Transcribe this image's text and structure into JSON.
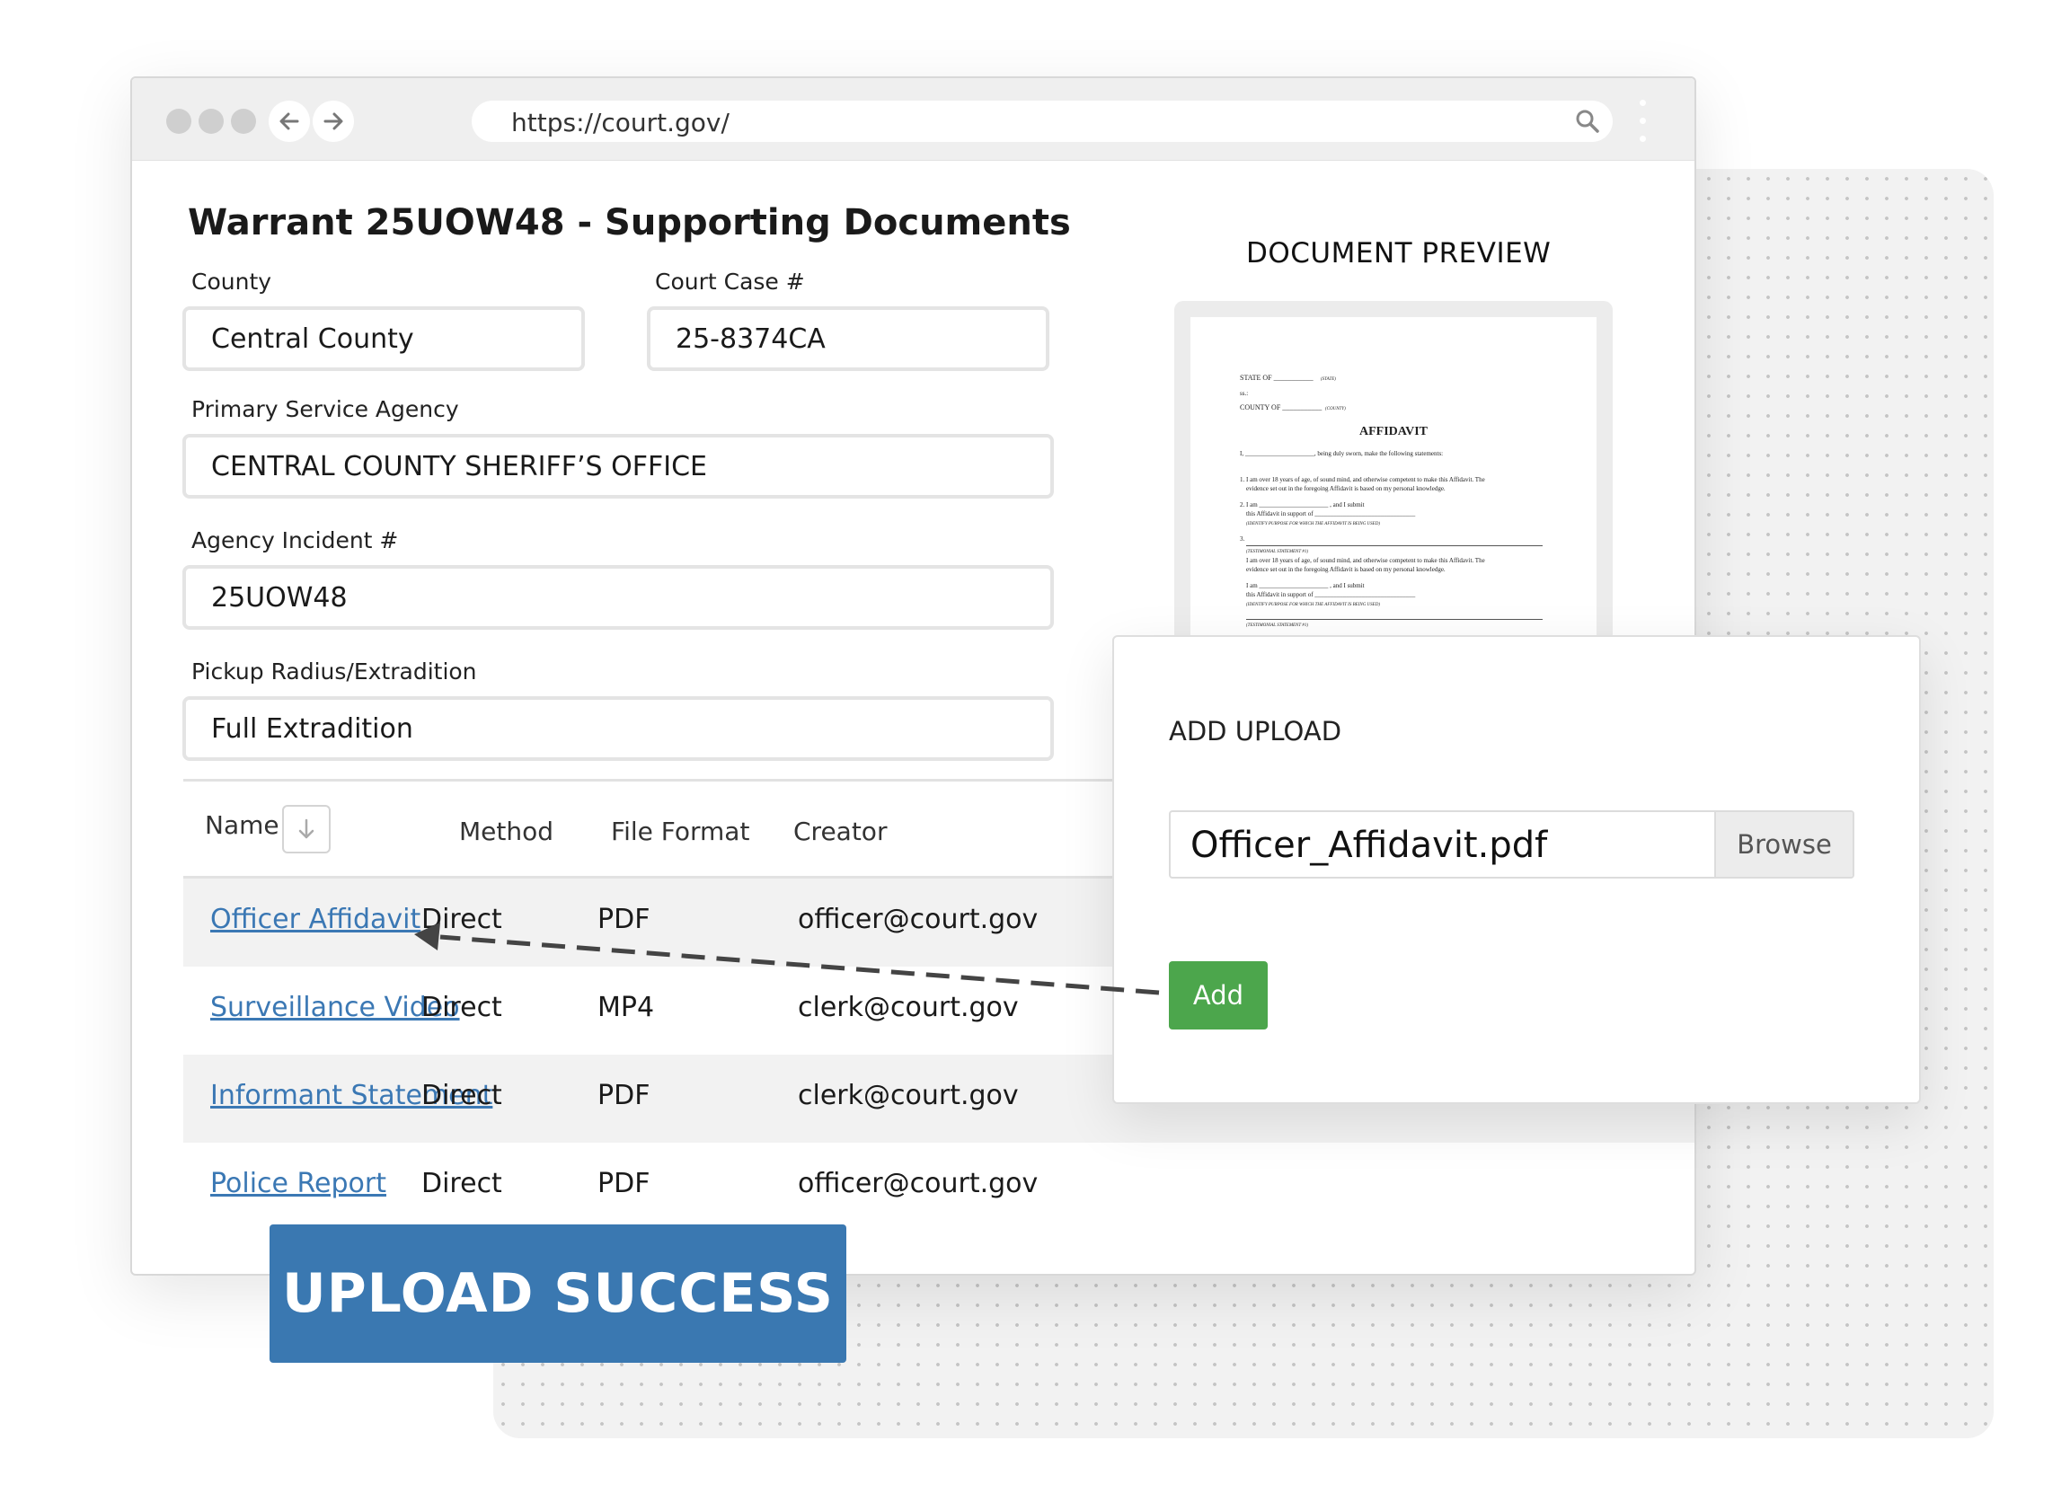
{
  "browser": {
    "url": "https://court.gov/",
    "icons": [
      "arrow-left-icon",
      "arrow-right-icon",
      "search-icon",
      "kebab-menu-icon"
    ]
  },
  "page": {
    "title": "Warrant 25UOW48 - Supporting Documents"
  },
  "form": {
    "county": {
      "label": "County",
      "value": "Central County"
    },
    "court_case": {
      "label": "Court Case #",
      "value": "25-8374CA"
    },
    "agency": {
      "label": "Primary Service Agency",
      "value": "CENTRAL COUNTY SHERIFF’S OFFICE"
    },
    "incident": {
      "label": "Agency Incident #",
      "value": "25UOW48"
    },
    "radius": {
      "label": "Pickup Radius/Extradition",
      "value": "Full Extradition"
    }
  },
  "table": {
    "headers": {
      "name": "Name",
      "method": "Method",
      "format": "File Format",
      "creator": "Creator"
    },
    "rows": [
      {
        "name": "Officer Affidavit",
        "method": "Direct",
        "format": "PDF",
        "creator": "officer@court.gov"
      },
      {
        "name": "Surveillance Video",
        "method": "Direct",
        "format": "MP4",
        "creator": "clerk@court.gov"
      },
      {
        "name": "Informant Statement",
        "method": "Direct",
        "format": "PDF",
        "creator": "clerk@court.gov"
      },
      {
        "name": "Police Report",
        "method": "Direct",
        "format": "PDF",
        "creator": "officer@court.gov"
      }
    ]
  },
  "preview": {
    "title": "DOCUMENT PREVIEW",
    "doc": {
      "state_line": "STATE OF ___________",
      "state_note": "(STATE)",
      "ss": "ss.:",
      "county_line": "COUNTY OF ___________",
      "county_note": "(COUNTY)",
      "heading": "AFFIDAVIT",
      "intro": "I, ______________________, being duly sworn, make the following statements:",
      "p1a": "1. I am over 18 years of age, of sound mind, and otherwise competent to make this Affidavit. The",
      "p1b": "evidence set out in the foregoing Affidavit is based on my personal knowledge.",
      "p2a": "2. I am ______________________ , and I submit",
      "p2b": "this Affidavit in support of ________________________________",
      "p2c": "(IDENTIFY PURPOSE FOR WHICH THE AFFIDAVIT IS BEING USED)",
      "p3": "3.",
      "p3note": "(TESTIMONIAL STATEMENT #1)",
      "p4a": "I am over 18 years of age, of sound mind, and otherwise competent to make this Affidavit. The",
      "p4b": "evidence set out in the foregoing Affidavit is based on my personal knowledge.",
      "p5a": "I am ______________________ , and I submit",
      "p5b": "this Affidavit in support of ________________________________",
      "p5c": "(IDENTIFY PURPOSE FOR WHICH THE AFFIDAVIT IS BEING USED)",
      "p6note": "(TESTIMONIAL STATEMENT #1)"
    }
  },
  "modal": {
    "title": "ADD UPLOAD",
    "file_value": "Officer_Affidavit.pdf",
    "browse_label": "Browse",
    "add_label": "Add"
  },
  "banner": {
    "text": "UPLOAD SUCCESS"
  },
  "colors": {
    "link": "#3b78b4",
    "add_button": "#4ca64c",
    "banner": "#3a78b1"
  }
}
